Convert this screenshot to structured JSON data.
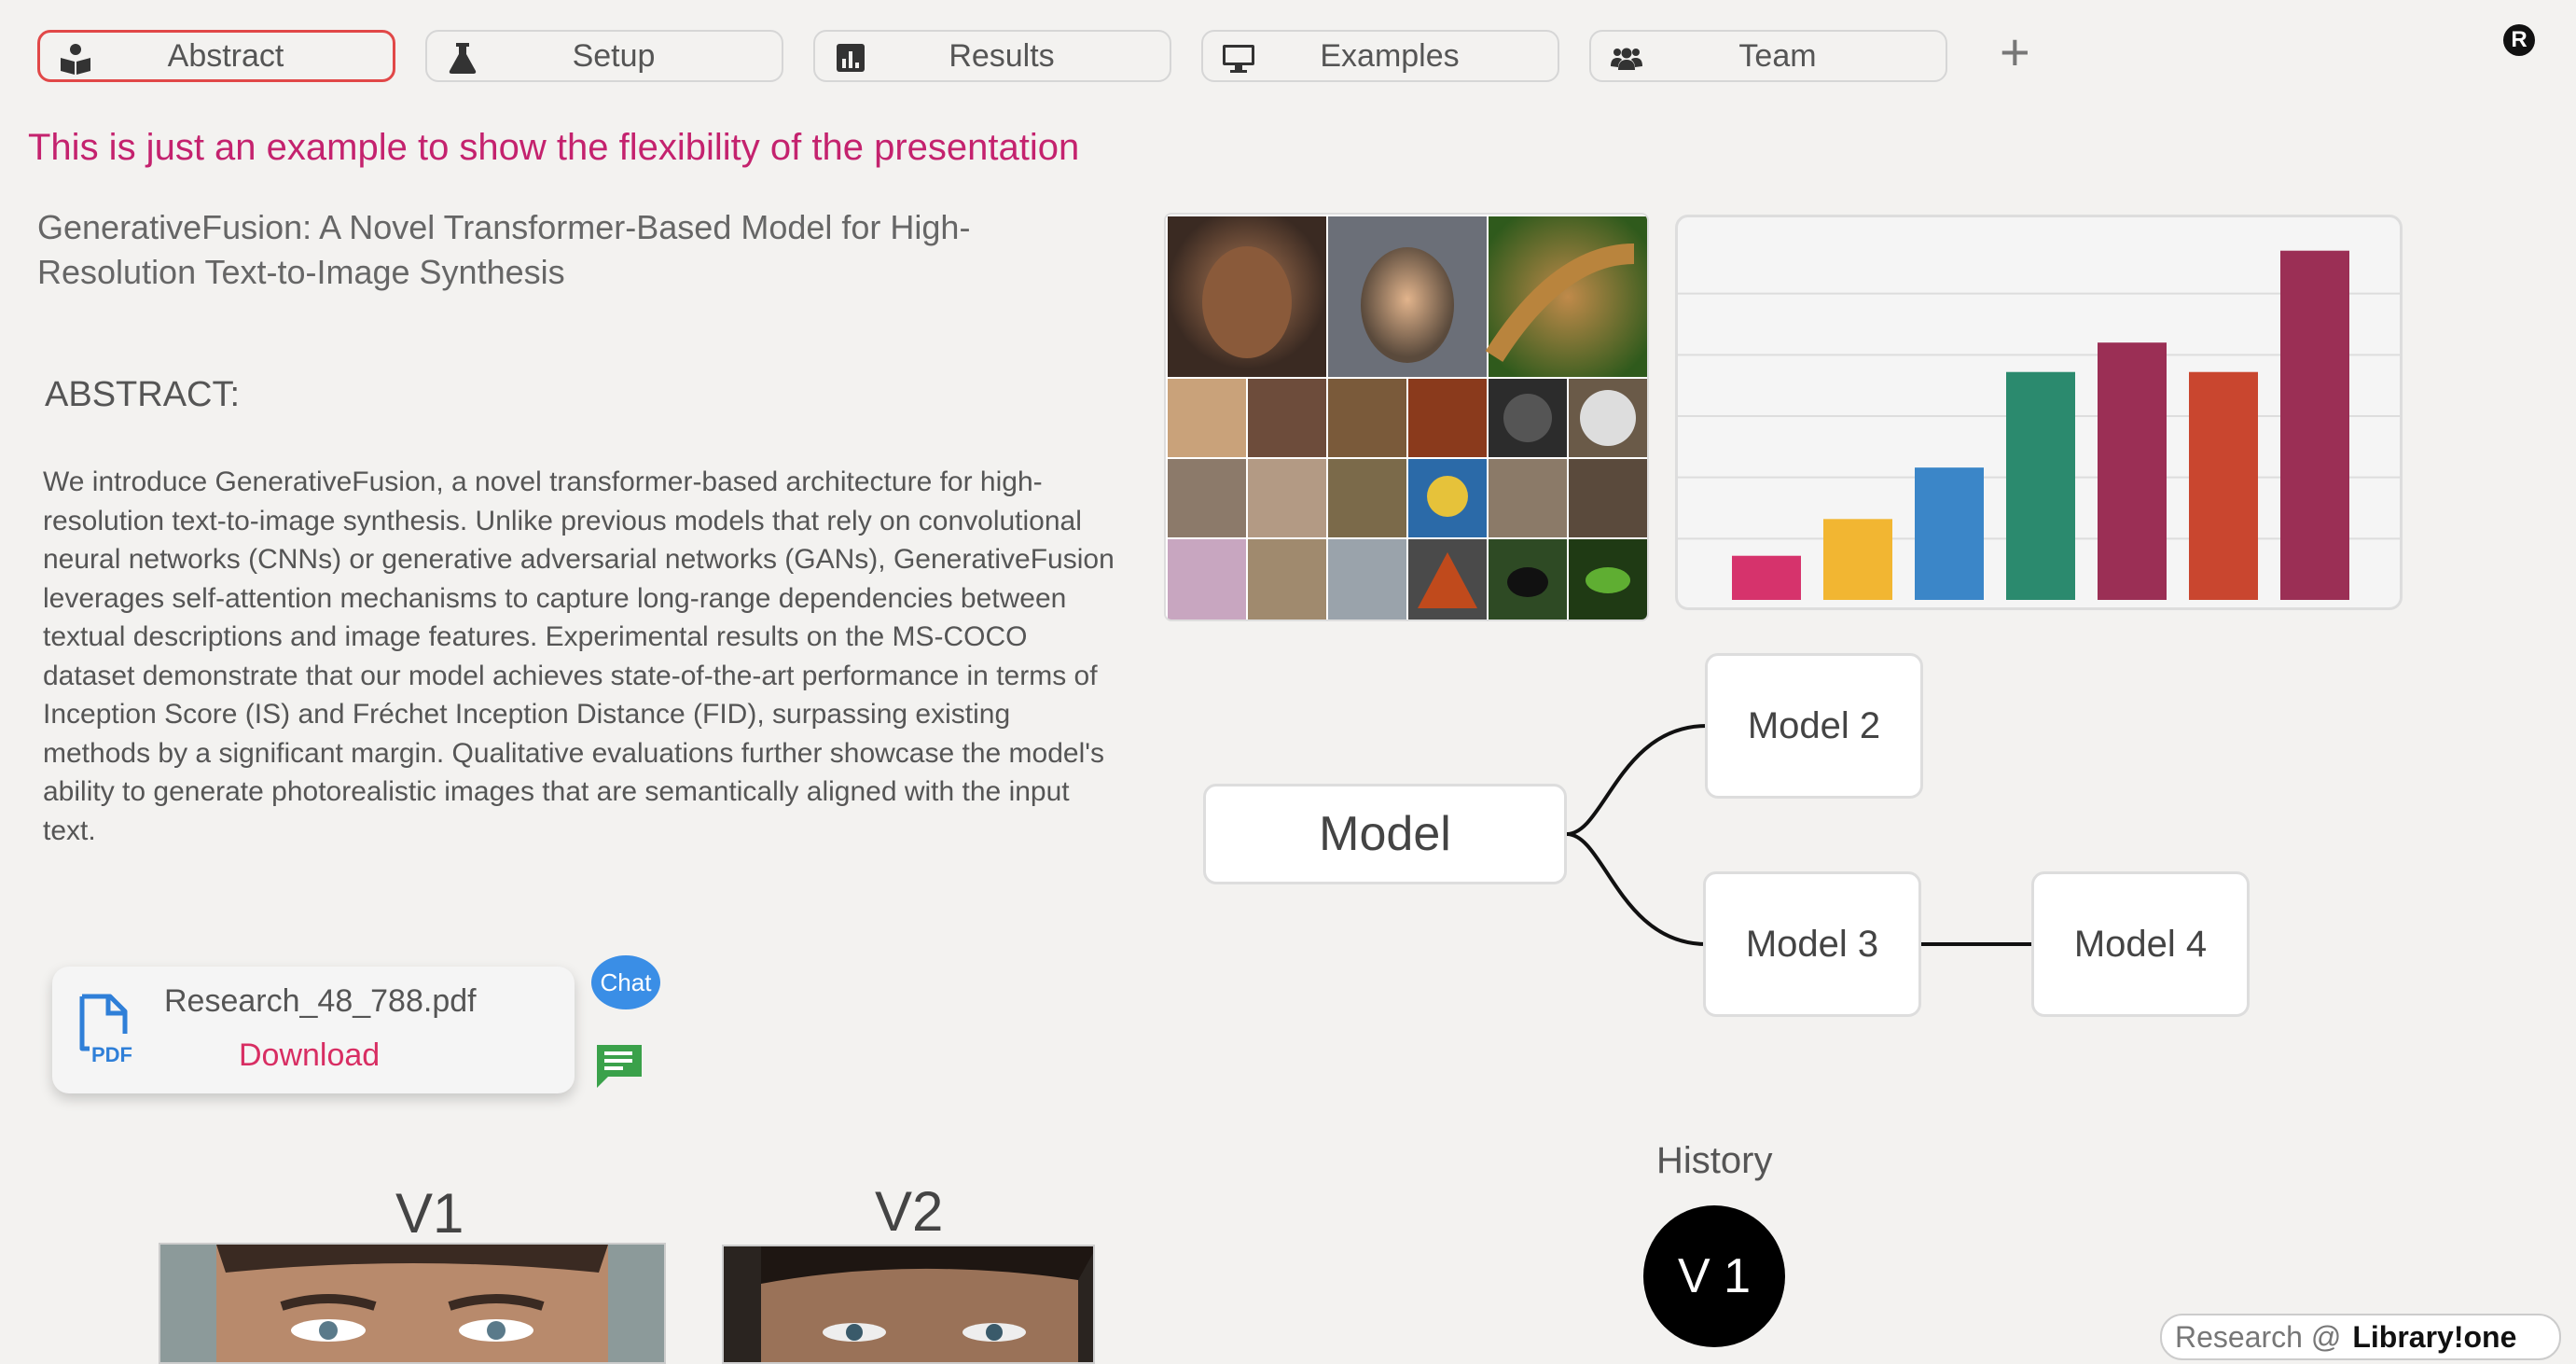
{
  "tabs": [
    {
      "label": "Abstract",
      "icon": "reader-icon",
      "active": true
    },
    {
      "label": "Setup",
      "icon": "flask-icon",
      "active": false
    },
    {
      "label": "Results",
      "icon": "chart-icon",
      "active": false
    },
    {
      "label": "Examples",
      "icon": "monitor-icon",
      "active": false
    },
    {
      "label": "Team",
      "icon": "users-icon",
      "active": false
    }
  ],
  "add_tab_label": "+",
  "user_badge": "R",
  "note": "This is just an example to show the flexibility of the presentation",
  "paper_title": "GenerativeFusion: A Novel Transformer-Based Model for High-Resolution Text-to-Image Synthesis",
  "abstract_heading": "ABSTRACT:",
  "abstract_text": "We introduce GenerativeFusion, a novel transformer-based architecture for high-resolution text-to-image synthesis. Unlike previous models that rely on convolutional neural networks (CNNs) or generative adversarial networks (GANs), GenerativeFusion leverages self-attention mechanisms to capture long-range dependencies between textual descriptions and image features. Experimental results on the MS-COCO dataset demonstrate that our model achieves state-of-the-art performance in terms of Inception Score (IS) and Fréchet Inception Distance (FID), surpassing existing methods by a significant margin. Qualitative evaluations further showcase the model's ability to generate photorealistic images that are semantically aligned with the input text.",
  "chart_data": {
    "type": "bar",
    "values": [
      12,
      22,
      36,
      62,
      70,
      62,
      95
    ],
    "colors": [
      "#d6336c",
      "#f2b632",
      "#3b86c8",
      "#2b8a6e",
      "#9b2f55",
      "#c9462f",
      "#9b2f55"
    ],
    "ylim": [
      0,
      100
    ],
    "grid": true
  },
  "diagram": {
    "root": "Model",
    "branch_a": "Model 2",
    "branch_b": "Model 3",
    "leaf": "Model 4"
  },
  "pdf": {
    "filename": "Research_48_788.pdf",
    "download_label": "Download",
    "icon_text": "PDF"
  },
  "chat_label": "Chat",
  "versions": [
    {
      "label": "V1"
    },
    {
      "label": "V2"
    }
  ],
  "history": {
    "label": "History",
    "current": "V 1"
  },
  "footer": {
    "prefix": "Research @",
    "brand": "Library!one"
  }
}
